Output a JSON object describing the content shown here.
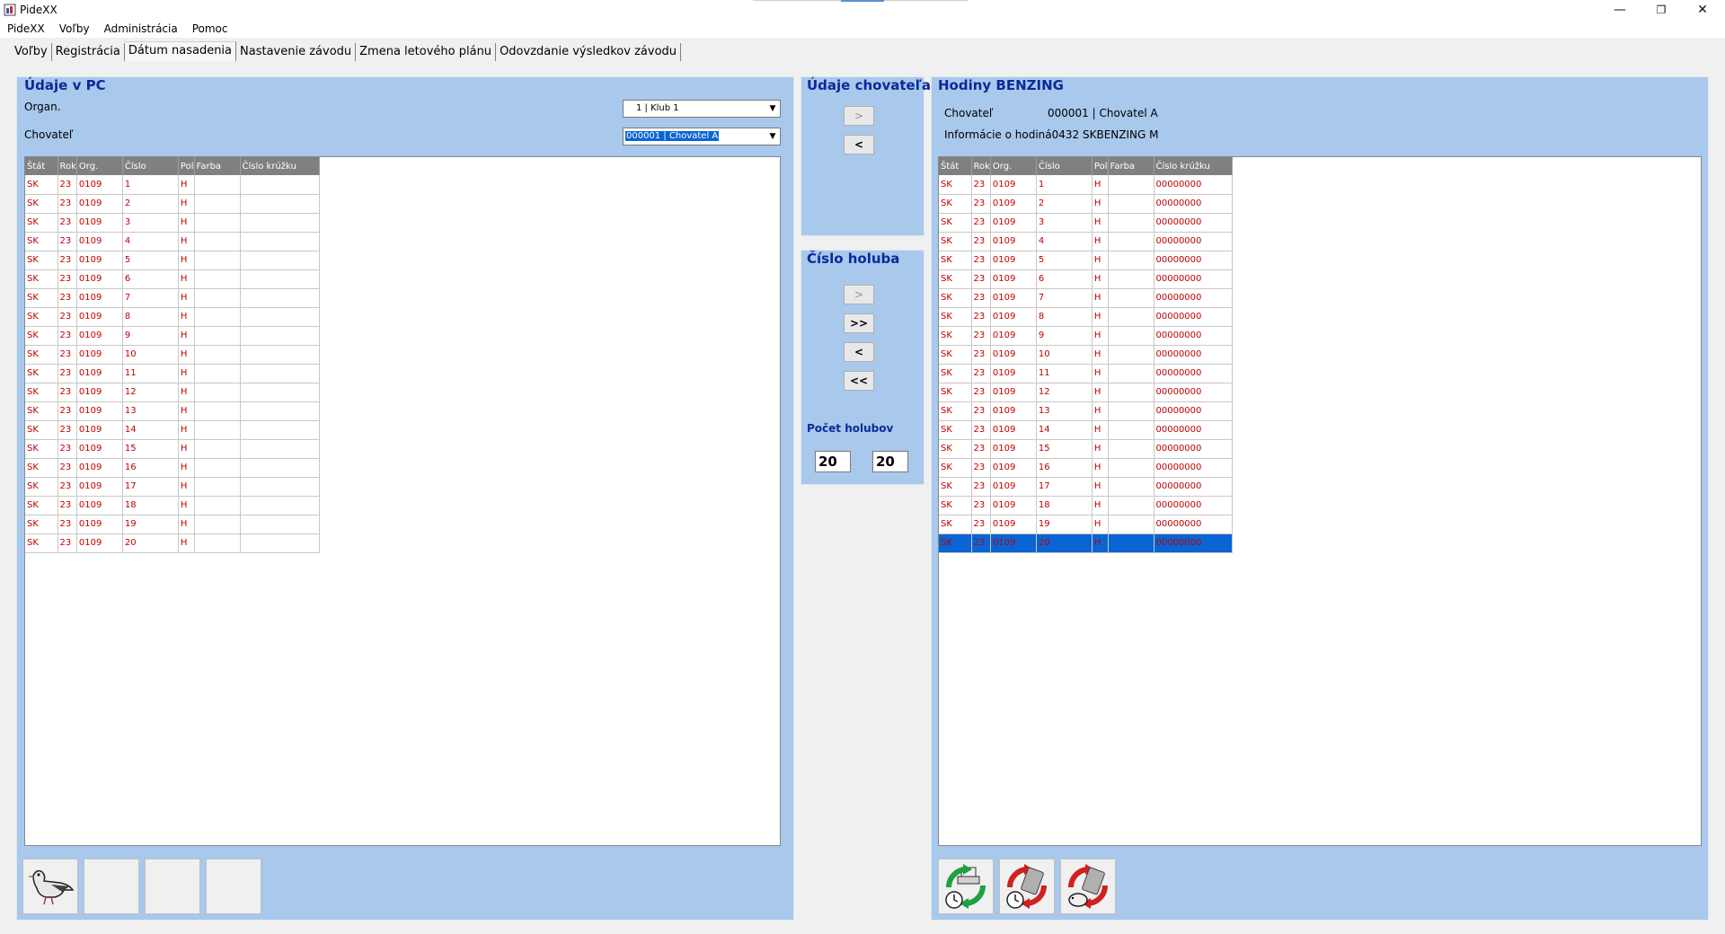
{
  "window": {
    "title": "PideXX",
    "minimize": "—",
    "restore": "❐",
    "close": "✕"
  },
  "menu": [
    "PideXX",
    "Voľby",
    "Administrácia",
    "Pomoc"
  ],
  "tabs": [
    "Voľby",
    "Registrácia",
    "Dátum nasadenia",
    "Nastavenie závodu",
    "Zmena letového plánu",
    "Odovzdanie výsledkov závodu"
  ],
  "active_tab": "Dátum nasadenia",
  "left_panel": {
    "title": "Údaje v PC",
    "organ_label": "Organ.",
    "organ_value": "1 | Klub 1",
    "breeder_label": "Chovateľ",
    "breeder_value": "000001 | Chovatel A",
    "columns": [
      "Štát",
      "Rok",
      "Org.",
      "Číslo",
      "Pol",
      "Farba",
      "Číslo krúžku"
    ],
    "rows": [
      [
        "SK",
        "23",
        "0109",
        "1",
        "H",
        "",
        ""
      ],
      [
        "SK",
        "23",
        "0109",
        "2",
        "H",
        "",
        ""
      ],
      [
        "SK",
        "23",
        "0109",
        "3",
        "H",
        "",
        ""
      ],
      [
        "SK",
        "23",
        "0109",
        "4",
        "H",
        "",
        ""
      ],
      [
        "SK",
        "23",
        "0109",
        "5",
        "H",
        "",
        ""
      ],
      [
        "SK",
        "23",
        "0109",
        "6",
        "H",
        "",
        ""
      ],
      [
        "SK",
        "23",
        "0109",
        "7",
        "H",
        "",
        ""
      ],
      [
        "SK",
        "23",
        "0109",
        "8",
        "H",
        "",
        ""
      ],
      [
        "SK",
        "23",
        "0109",
        "9",
        "H",
        "",
        ""
      ],
      [
        "SK",
        "23",
        "0109",
        "10",
        "H",
        "",
        ""
      ],
      [
        "SK",
        "23",
        "0109",
        "11",
        "H",
        "",
        ""
      ],
      [
        "SK",
        "23",
        "0109",
        "12",
        "H",
        "",
        ""
      ],
      [
        "SK",
        "23",
        "0109",
        "13",
        "H",
        "",
        ""
      ],
      [
        "SK",
        "23",
        "0109",
        "14",
        "H",
        "",
        ""
      ],
      [
        "SK",
        "23",
        "0109",
        "15",
        "H",
        "",
        ""
      ],
      [
        "SK",
        "23",
        "0109",
        "16",
        "H",
        "",
        ""
      ],
      [
        "SK",
        "23",
        "0109",
        "17",
        "H",
        "",
        ""
      ],
      [
        "SK",
        "23",
        "0109",
        "18",
        "H",
        "",
        ""
      ],
      [
        "SK",
        "23",
        "0109",
        "19",
        "H",
        "",
        ""
      ],
      [
        "SK",
        "23",
        "0109",
        "20",
        "H",
        "",
        ""
      ]
    ]
  },
  "breeder_panel": {
    "title": "Údaje chovateľa",
    "btn_right": ">",
    "btn_left": "<"
  },
  "pigeon_panel": {
    "title": "Číslo holuba",
    "btn_right": ">",
    "btn_all_right": ">>",
    "btn_left": "<",
    "btn_all_left": "<<",
    "count_label": "Počet holubov",
    "count_left": "20",
    "count_right": "20"
  },
  "right_panel": {
    "title": "Hodiny BENZING",
    "breeder_label": "Chovateľ",
    "breeder_value": "000001 | Chovatel A",
    "clock_info_label": "Informácie o hodiná",
    "clock_info_value": "0432 SKBENZING M",
    "columns": [
      "Štát",
      "Rok",
      "Org.",
      "Číslo",
      "Pol",
      "Farba",
      "Číslo krúžku"
    ],
    "rows": [
      [
        "SK",
        "23",
        "0109",
        "1",
        "H",
        "",
        "00000000"
      ],
      [
        "SK",
        "23",
        "0109",
        "2",
        "H",
        "",
        "00000000"
      ],
      [
        "SK",
        "23",
        "0109",
        "3",
        "H",
        "",
        "00000000"
      ],
      [
        "SK",
        "23",
        "0109",
        "4",
        "H",
        "",
        "00000000"
      ],
      [
        "SK",
        "23",
        "0109",
        "5",
        "H",
        "",
        "00000000"
      ],
      [
        "SK",
        "23",
        "0109",
        "6",
        "H",
        "",
        "00000000"
      ],
      [
        "SK",
        "23",
        "0109",
        "7",
        "H",
        "",
        "00000000"
      ],
      [
        "SK",
        "23",
        "0109",
        "8",
        "H",
        "",
        "00000000"
      ],
      [
        "SK",
        "23",
        "0109",
        "9",
        "H",
        "",
        "00000000"
      ],
      [
        "SK",
        "23",
        "0109",
        "10",
        "H",
        "",
        "00000000"
      ],
      [
        "SK",
        "23",
        "0109",
        "11",
        "H",
        "",
        "00000000"
      ],
      [
        "SK",
        "23",
        "0109",
        "12",
        "H",
        "",
        "00000000"
      ],
      [
        "SK",
        "23",
        "0109",
        "13",
        "H",
        "",
        "00000000"
      ],
      [
        "SK",
        "23",
        "0109",
        "14",
        "H",
        "",
        "00000000"
      ],
      [
        "SK",
        "23",
        "0109",
        "15",
        "H",
        "",
        "00000000"
      ],
      [
        "SK",
        "23",
        "0109",
        "16",
        "H",
        "",
        "00000000"
      ],
      [
        "SK",
        "23",
        "0109",
        "17",
        "H",
        "",
        "00000000"
      ],
      [
        "SK",
        "23",
        "0109",
        "18",
        "H",
        "",
        "00000000"
      ],
      [
        "SK",
        "23",
        "0109",
        "19",
        "H",
        "",
        "00000000"
      ],
      [
        "SK",
        "23",
        "0109",
        "20",
        "H",
        "",
        "00000000"
      ]
    ],
    "selected_row": 19
  },
  "toolbar_left": [
    "pigeon-icon",
    "",
    "",
    ""
  ],
  "toolbar_right": [
    "clock-sync-icon",
    "clock-delete-icon",
    "clock-delete-pigeon-icon"
  ],
  "colors": {
    "panel_bg": "#a8c8ec",
    "title_color": "#0a2a9a",
    "row_text": "#c00000",
    "selection": "#0a64d4",
    "header_bg": "#808080"
  }
}
